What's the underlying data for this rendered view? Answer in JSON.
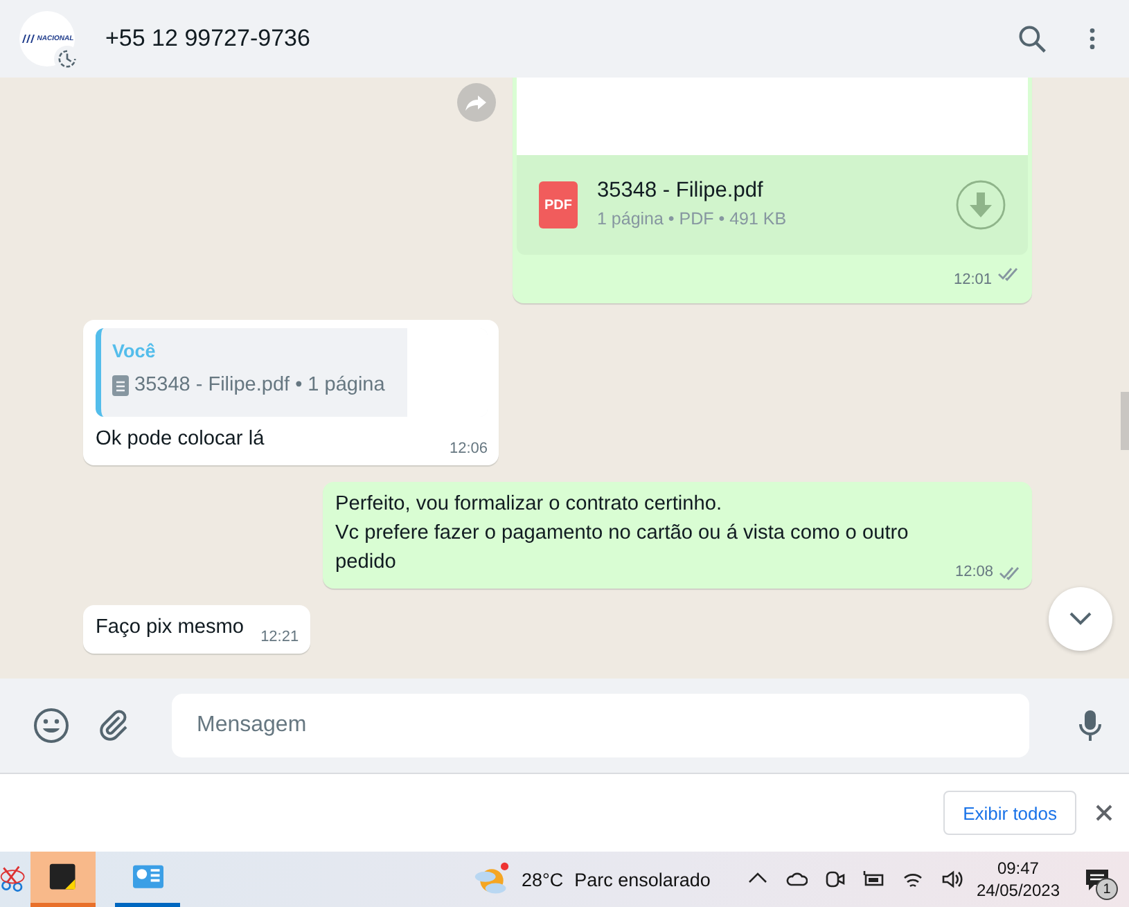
{
  "header": {
    "avatar_logo": "NACIONAL",
    "contact": "+55 12 99727-9736"
  },
  "messages": [
    {
      "kind": "document",
      "outgoing": true,
      "file_name": "35348 - Filipe.pdf",
      "file_badge": "PDF",
      "details": "1 página • PDF • 491 KB",
      "time": "12:01",
      "read": false
    },
    {
      "kind": "reply",
      "outgoing": false,
      "quote_author": "Você",
      "quote_text": "35348 - Filipe.pdf • 1 página",
      "text": "Ok pode colocar lá",
      "time": "12:06"
    },
    {
      "kind": "text",
      "outgoing": true,
      "text": "Perfeito, vou formalizar o contrato certinho.\nVc prefere fazer o pagamento no cartão ou á vista como o outro pedido",
      "time": "12:08",
      "read": false
    },
    {
      "kind": "text",
      "outgoing": false,
      "text": "Faço pix mesmo",
      "time": "12:21"
    }
  ],
  "composer": {
    "placeholder": "Mensagem"
  },
  "download_bar": {
    "button": "Exibir todos"
  },
  "taskbar": {
    "apps": [
      {
        "kind": "snip",
        "selected": false,
        "running": false
      },
      {
        "kind": "sticky",
        "selected": true,
        "running": true
      },
      {
        "kind": "app",
        "selected": false,
        "running": true
      }
    ],
    "weather_temp": "28°C",
    "weather_text": "Parc ensolarado",
    "time": "09:47",
    "date": "24/05/2023",
    "notification_count": "1"
  }
}
